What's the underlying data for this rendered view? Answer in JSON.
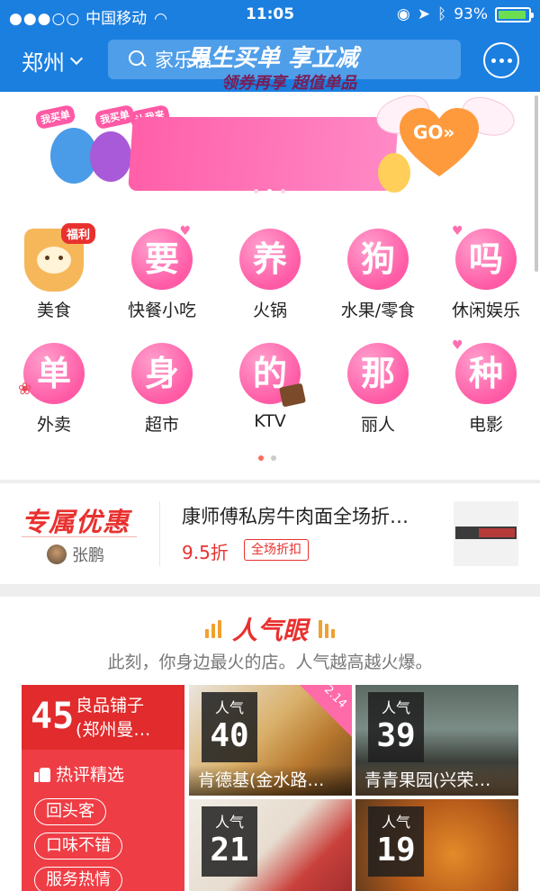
{
  "status_bar": {
    "carrier": "中国移动",
    "time": "11:05",
    "battery": "93%",
    "battery_level": 0.93
  },
  "nav": {
    "city": "郑州",
    "search_placeholder": "家乐福"
  },
  "banner": {
    "title": "男生买单 享立减",
    "subtitle": "领券再享 超值单品",
    "stickers": [
      "我买单",
      "我买单",
      "让我来"
    ],
    "go": "GO»"
  },
  "categories_row1": [
    {
      "label": "美食",
      "badge": "福利"
    },
    {
      "label": "快餐小吃",
      "glyph": "要"
    },
    {
      "label": "火锅",
      "glyph": "养"
    },
    {
      "label": "水果/零食",
      "glyph": "狗"
    },
    {
      "label": "休闲娱乐",
      "glyph": "吗"
    }
  ],
  "categories_row2": [
    {
      "label": "外卖",
      "glyph": "单"
    },
    {
      "label": "超市",
      "glyph": "身"
    },
    {
      "label": "KTV",
      "glyph": "的"
    },
    {
      "label": "丽人",
      "glyph": "那"
    },
    {
      "label": "电影",
      "glyph": "种"
    }
  ],
  "promo": {
    "brand": "专属优惠",
    "user": "张鹏",
    "title": "康师傅私房牛肉面全场折…",
    "discount": "9.5折",
    "tag": "全场折扣"
  },
  "popular": {
    "title": "人气眼",
    "subtitle": "此刻，你身边最火的店。人气越高越火爆。",
    "featured": {
      "rank": "45",
      "name_line1": "良品铺子",
      "name_line2": "(郑州曼…",
      "hot_label": "热评精选",
      "tags": [
        "回头客",
        "口味不错",
        "服务热情"
      ]
    },
    "badge_label": "人气",
    "corner_date": "2.14",
    "cards": [
      {
        "rank": "40",
        "name": "肯德基(金水路…"
      },
      {
        "rank": "39",
        "name": "青青果园(兴荣…"
      },
      {
        "rank": "21",
        "name": ""
      },
      {
        "rank": "19",
        "name": ""
      }
    ]
  },
  "colors": {
    "nav_blue": "#1b7fe0",
    "brand_red": "#e8312f",
    "pink": "#ff5aa5"
  }
}
